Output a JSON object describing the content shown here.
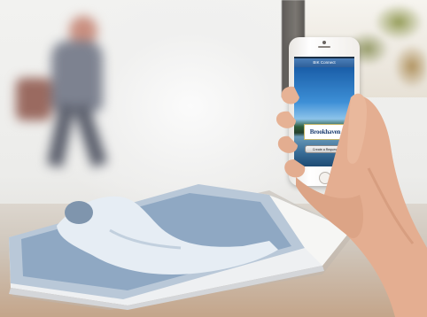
{
  "scene": {
    "description_tag": "person-holding-phone-over-magazine"
  },
  "phone_app": {
    "nav_title": "BIK Connect",
    "logo_text": "Brookhaven",
    "request_button_label": "Create a Request"
  },
  "colors": {
    "nav_bar": "#2e5f99",
    "screen_bg": "#10324f",
    "table_wood": "#c4a58a",
    "skin": "#e8b79a"
  }
}
